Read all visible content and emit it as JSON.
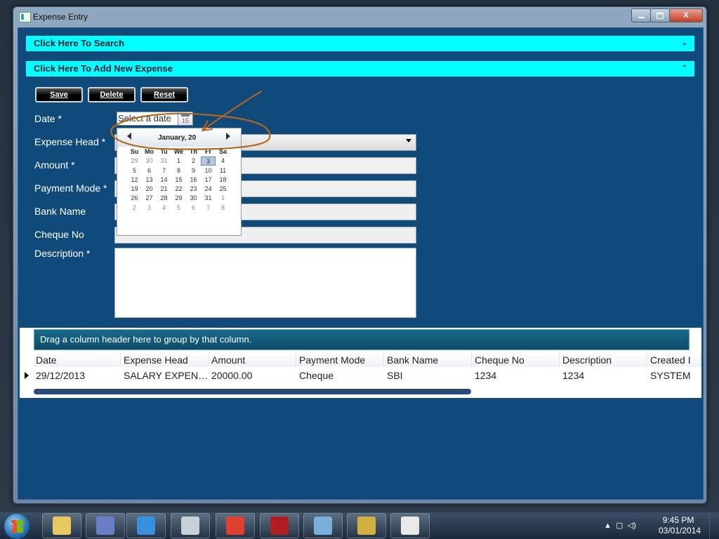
{
  "window": {
    "title": "Expense Entry",
    "minimize_icon": "minimize-icon",
    "maximize_icon": "maximize-icon",
    "close_icon": "close-icon",
    "close_symbol": "X"
  },
  "expanders": {
    "search": {
      "label": "Click Here To Search",
      "icon": "chevron-down-icon",
      "symbol": "⌄"
    },
    "add": {
      "label": "Click Here To Add New Expense",
      "icon": "chevron-up-icon",
      "symbol": "⌃"
    }
  },
  "toolbar": {
    "save_label": "Save",
    "delete_label": "Delete",
    "reset_label": "Reset"
  },
  "form": {
    "date_label": "Date *",
    "date_placeholder": "Select a date",
    "calendar_button_text": "15",
    "expense_head_label": "Expense Head *",
    "amount_label": "Amount *",
    "payment_mode_label": "Payment Mode *",
    "bank_name_label": "Bank Name",
    "cheque_no_label": "Cheque No",
    "description_label": "Description *"
  },
  "calendar": {
    "month_label": "January, 20",
    "weekdays": [
      "Su",
      "Mo",
      "Tu",
      "We",
      "Th",
      "Fr",
      "Sa"
    ],
    "days": [
      [
        "29",
        "30",
        "31",
        "1",
        "2",
        "3",
        "4"
      ],
      [
        "5",
        "6",
        "7",
        "8",
        "9",
        "10",
        "11"
      ],
      [
        "12",
        "13",
        "14",
        "15",
        "16",
        "17",
        "18"
      ],
      [
        "19",
        "20",
        "21",
        "22",
        "23",
        "24",
        "25"
      ],
      [
        "26",
        "27",
        "28",
        "29",
        "30",
        "31",
        "1"
      ],
      [
        "2",
        "3",
        "4",
        "5",
        "6",
        "7",
        "8"
      ]
    ],
    "selected_day": "3"
  },
  "grid": {
    "group_hint": "Drag a column header here to group by that column.",
    "columns": [
      "Date",
      "Expense Head",
      "Amount",
      "Payment Mode",
      "Bank Name",
      "Cheque No",
      "Description",
      "Created I"
    ],
    "rows": [
      [
        "29/12/2013",
        "SALARY EXPEN…",
        "20000.00",
        "Cheque",
        "SBI",
        "1234",
        "1234",
        "SYSTEM"
      ]
    ]
  },
  "taskbar": {
    "apps": [
      "file-explorer-icon",
      "visual-studio-icon",
      "internet-explorer-icon",
      "calculator-icon",
      "chrome-icon",
      "winrar-icon",
      "sql-icon",
      "tools-icon",
      "terminal-icon"
    ],
    "time": "9:45 PM",
    "date": "03/01/2014"
  },
  "colors": {
    "accent": "#00ffff",
    "client_bg": "#0f4a7a",
    "annotation": "#b5651d"
  }
}
